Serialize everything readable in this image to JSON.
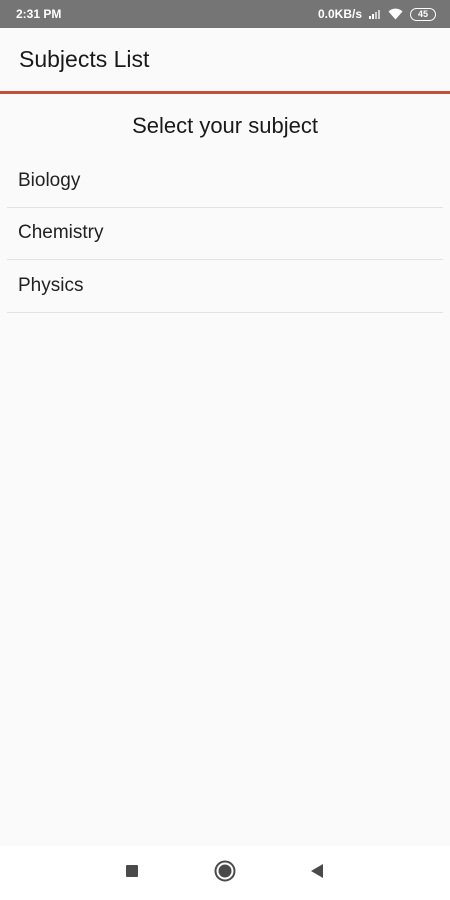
{
  "status_bar": {
    "time": "2:31 PM",
    "network_speed": "0.0KB/s",
    "battery_level": "45",
    "icons": [
      "signal-icon",
      "wifi-icon",
      "battery-icon"
    ]
  },
  "app_bar": {
    "title": "Subjects List",
    "accent_color": "#c0503a"
  },
  "main": {
    "heading": "Select your subject",
    "subjects": [
      {
        "label": "Biology"
      },
      {
        "label": "Chemistry"
      },
      {
        "label": "Physics"
      }
    ]
  },
  "nav_bar": {
    "buttons": [
      "recent-apps-icon",
      "home-icon",
      "back-icon"
    ]
  }
}
